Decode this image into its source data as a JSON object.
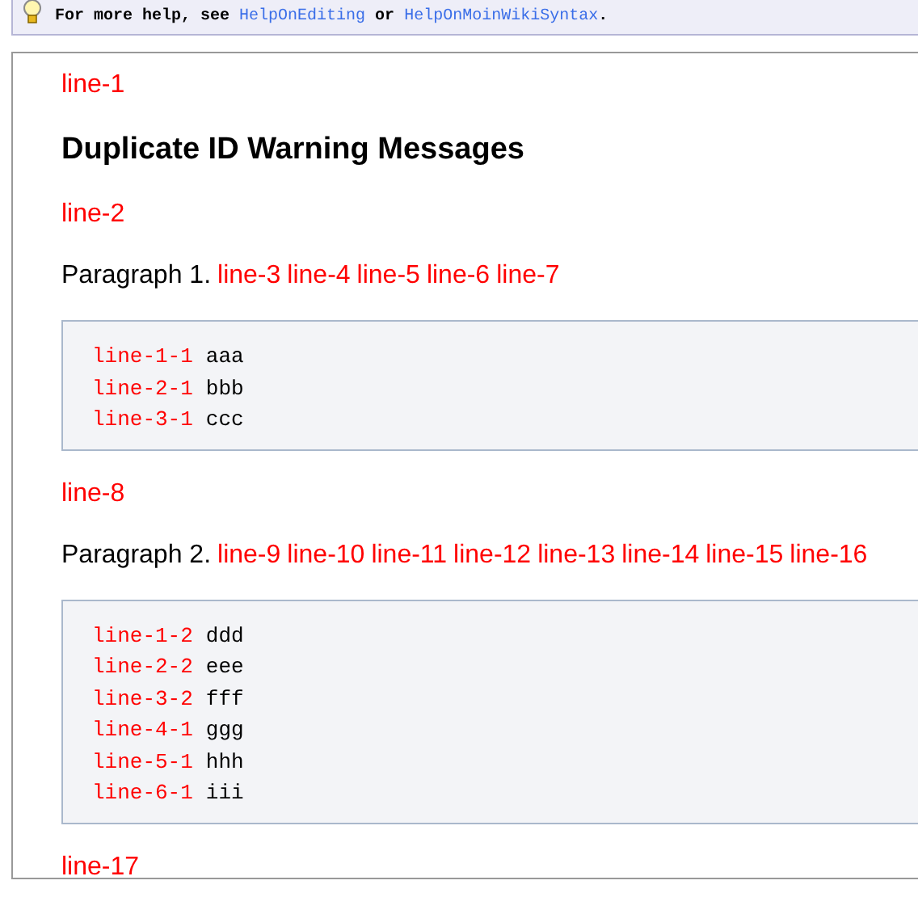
{
  "help_bar": {
    "prefix": "For more help, see",
    "links": [
      "HelpOnEditing",
      "HelpOnMoinWikiSyntax"
    ],
    "joiner": "or",
    "suffix": "."
  },
  "content": [
    {
      "kind": "anchor",
      "text": "line-1"
    },
    {
      "kind": "heading",
      "text": "Duplicate ID Warning Messages"
    },
    {
      "kind": "anchor",
      "text": "line-2"
    },
    {
      "kind": "paragraph",
      "text": "Paragraph 1.",
      "anchors": [
        "line-3",
        "line-4",
        "line-5",
        "line-6",
        "line-7"
      ]
    },
    {
      "kind": "code",
      "lines": [
        {
          "anchor": "line-1-1",
          "text": "aaa"
        },
        {
          "anchor": "line-2-1",
          "text": "bbb"
        },
        {
          "anchor": "line-3-1",
          "text": "ccc"
        }
      ]
    },
    {
      "kind": "anchor",
      "text": "line-8"
    },
    {
      "kind": "paragraph",
      "text": "Paragraph 2.",
      "anchors": [
        "line-9",
        "line-10",
        "line-11",
        "line-12",
        "line-13",
        "line-14",
        "line-15",
        "line-16"
      ]
    },
    {
      "kind": "code",
      "lines": [
        {
          "anchor": "line-1-2",
          "text": "ddd"
        },
        {
          "anchor": "line-2-2",
          "text": "eee"
        },
        {
          "anchor": "line-3-2",
          "text": "fff"
        },
        {
          "anchor": "line-4-1",
          "text": "ggg"
        },
        {
          "anchor": "line-5-1",
          "text": "hhh"
        },
        {
          "anchor": "line-6-1",
          "text": "iii"
        }
      ]
    },
    {
      "kind": "anchor",
      "text": "line-17"
    }
  ]
}
